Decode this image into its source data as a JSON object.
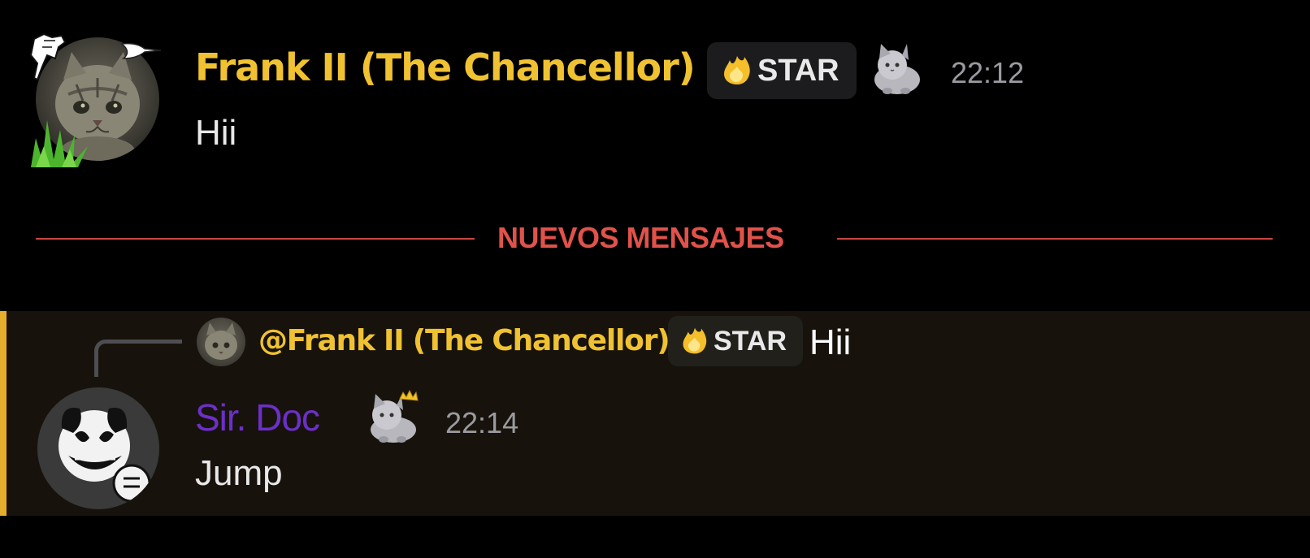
{
  "colors": {
    "background": "#000000",
    "username_gold": "#f0c232",
    "username_purple": "#6c2fc9",
    "new_messages_red": "#e0524a",
    "mention_highlight_bar": "#e5ad2c",
    "mention_highlight_bg": "#17130c",
    "timestamp": "#9a9aa0"
  },
  "messages": [
    {
      "author": "Frank II (The Chancellor)",
      "tag": {
        "icon": "flame-icon",
        "label": "STAR"
      },
      "badge": "cat-badge-icon",
      "avatar": "cat-avatar",
      "timestamp": "22:12",
      "content": "Hii"
    },
    {
      "reply": {
        "mention": "@Frank II (The Chancellor)",
        "tag": {
          "icon": "flame-icon",
          "label": "STAR"
        },
        "content": "Hii"
      },
      "author": "Sir. Doc",
      "badge": "crowned-cat-badge-icon",
      "avatar": "cartoon-avatar",
      "timestamp": "22:14",
      "content": "Jump"
    }
  ],
  "divider": {
    "label": "NUEVOS MENSAJES"
  }
}
